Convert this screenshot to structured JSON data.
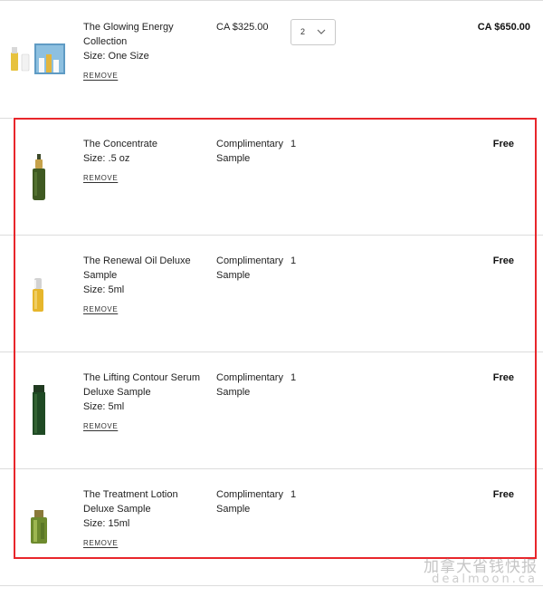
{
  "cart_items": [
    {
      "name": "The Glowing Energy Collection",
      "size": "Size: One Size",
      "remove_label": "REMOVE",
      "price": "CA $325.00",
      "quantity": "2",
      "total": "CA $650.00"
    },
    {
      "name": "The Concentrate",
      "size": "Size: .5 oz",
      "remove_label": "REMOVE",
      "price": "Complimentary Sample",
      "quantity": "1",
      "total": "Free"
    },
    {
      "name": "The Renewal Oil Deluxe Sample",
      "size": "Size: 5ml",
      "remove_label": "REMOVE",
      "price": "Complimentary Sample",
      "quantity": "1",
      "total": "Free"
    },
    {
      "name": "The Lifting Contour Serum Deluxe Sample",
      "size": "Size: 5ml",
      "remove_label": "REMOVE",
      "price": "Complimentary Sample",
      "quantity": "1",
      "total": "Free"
    },
    {
      "name": "The Treatment Lotion Deluxe Sample",
      "size": "Size: 15ml",
      "remove_label": "REMOVE",
      "price": "Complimentary Sample",
      "quantity": "1",
      "total": "Free"
    }
  ],
  "watermark": {
    "text_cn": "加拿大省钱快报",
    "text_en": "dealmoon.ca"
  },
  "colors": {
    "highlight_border": "#e8262b",
    "divider": "#dcdcdc"
  }
}
